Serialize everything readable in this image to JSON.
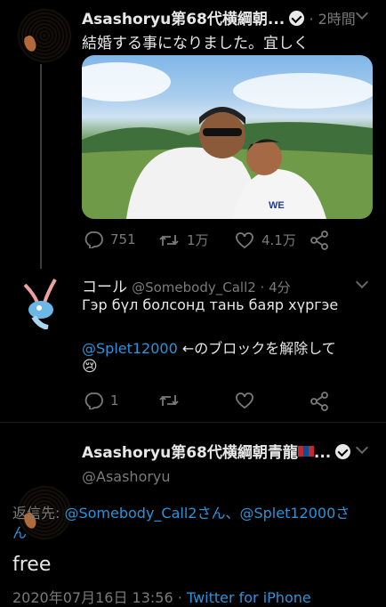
{
  "tweet1": {
    "name": "Asashoryu第68代横綱朝...",
    "time": "· 2時間",
    "text": "結婚する事になりました。宜しく",
    "replies": "751",
    "retweets": "1万",
    "likes": "4.1万"
  },
  "tweet2": {
    "name": "コール",
    "handle": "@Somebody_Call2 · 4分",
    "line1": "Гэр бүл болсонд тань баяр хүргэе",
    "mention": "@Splet12000",
    "line2_rest": " ←のブロックを解除して",
    "emoji": "😢",
    "replies": "1"
  },
  "main": {
    "name": "Asashoryu第68代横綱朝青龍",
    "name_suffix": "...",
    "handle": "@Asashoryu",
    "reply_prefix": "返信先: ",
    "reply_to1": "@Somebody_Call2さん、@Splet12000さ",
    "reply_to2": "ん",
    "text": "free",
    "date": "2020年07月16日 13:56",
    "dot": " · ",
    "source": "Twitter for iPhone"
  }
}
